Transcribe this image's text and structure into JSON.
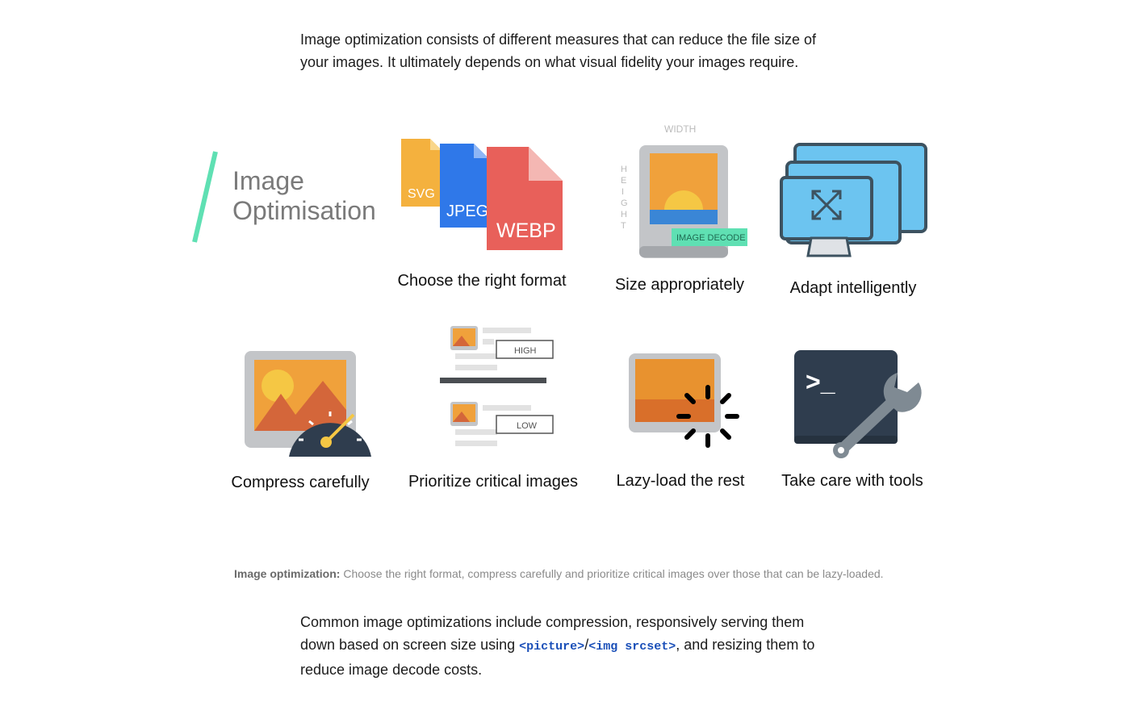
{
  "intro": {
    "line1": "Image optimization consists of different measures that can reduce the file size of",
    "line2": "your images. It ultimately depends on what visual fidelity your images require."
  },
  "figure": {
    "title_line1": "Image",
    "title_line2": "Optimisation",
    "accent_color": "#5fe0b3",
    "format_badges": [
      "SVG",
      "JPEG",
      "WEBP"
    ],
    "size_width_label": "WIDTH",
    "size_height_label": "HEIGHT",
    "decode_badge": "IMAGE DECODE",
    "priority_high": "HIGH",
    "priority_low": "LOW",
    "terminal_prompt": ">_",
    "items": [
      {
        "label": "Choose the right format"
      },
      {
        "label": "Size appropriately"
      },
      {
        "label": "Adapt intelligently"
      },
      {
        "label": "Compress carefully"
      },
      {
        "label": "Prioritize critical images"
      },
      {
        "label": "Lazy-load the rest"
      },
      {
        "label": "Take care with tools"
      }
    ]
  },
  "caption": {
    "bold": "Image optimization:",
    "text": " Choose the right format, compress carefully and prioritize critical images over those that can be lazy-loaded."
  },
  "outro": {
    "line1": "Common image optimizations include compression, responsively serving them",
    "line2_a": "down based on screen size using ",
    "code1": "<picture>",
    "sep": "/",
    "code2": "<img srcset>",
    "line2_b": ", and resizing them to",
    "line3": "reduce image decode costs."
  }
}
